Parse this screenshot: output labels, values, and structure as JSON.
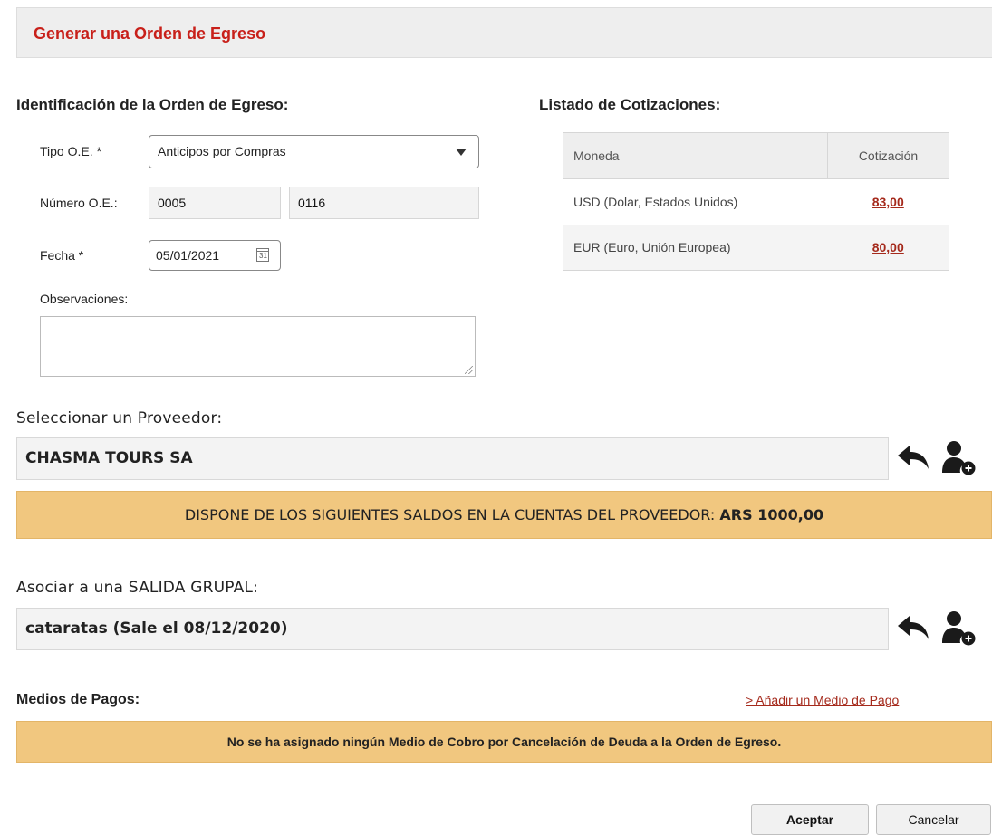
{
  "header": {
    "title": "Generar una Orden de Egreso"
  },
  "identificacion": {
    "title": "Identificación de la Orden de Egreso:",
    "tipo_label": "Tipo O.E. *",
    "tipo_value": "Anticipos por Compras",
    "numero_label": "Número O.E.:",
    "numero_prefix": "0005",
    "numero_value": "0116",
    "fecha_label": "Fecha *",
    "fecha_value": "05/01/2021",
    "calendar_glyph": "31",
    "observaciones_label": "Observaciones:",
    "observaciones_value": ""
  },
  "cotizaciones": {
    "title": "Listado de Cotizaciones:",
    "columns": [
      "Moneda",
      "Cotización"
    ],
    "rows": [
      {
        "moneda": "USD (Dolar, Estados Unidos)",
        "cotizacion": "83,00"
      },
      {
        "moneda": "EUR (Euro, Unión Europea)",
        "cotizacion": "80,00"
      }
    ]
  },
  "proveedor": {
    "label": "Seleccionar un Proveedor:",
    "value": "CHASMA TOURS SA",
    "saldo_text": "DISPONE DE LOS SIGUIENTES SALDOS EN LA CUENTAS DEL PROVEEDOR:",
    "saldo_amount": "ARS 1000,00"
  },
  "salida": {
    "label": "Asociar a una SALIDA GRUPAL:",
    "value": "cataratas (Sale el 08/12/2020)"
  },
  "medios": {
    "title": "Medios de Pagos:",
    "add_link": "> Añadir un Medio de Pago",
    "empty_message": "No se ha asignado ningún Medio de Cobro por Cancelación de Deuda a la Orden de Egreso."
  },
  "actions": {
    "accept": "Aceptar",
    "cancel": "Cancelar"
  },
  "icons": {
    "undo": "reply-arrow-icon",
    "add_user": "add-user-icon",
    "calendar": "calendar-icon",
    "dropdown": "chevron-down-icon"
  },
  "colors": {
    "title_red": "#c8201a",
    "link_red": "#a52a1c",
    "banner": "#f1c77f",
    "header_bg": "#eeeeee"
  }
}
